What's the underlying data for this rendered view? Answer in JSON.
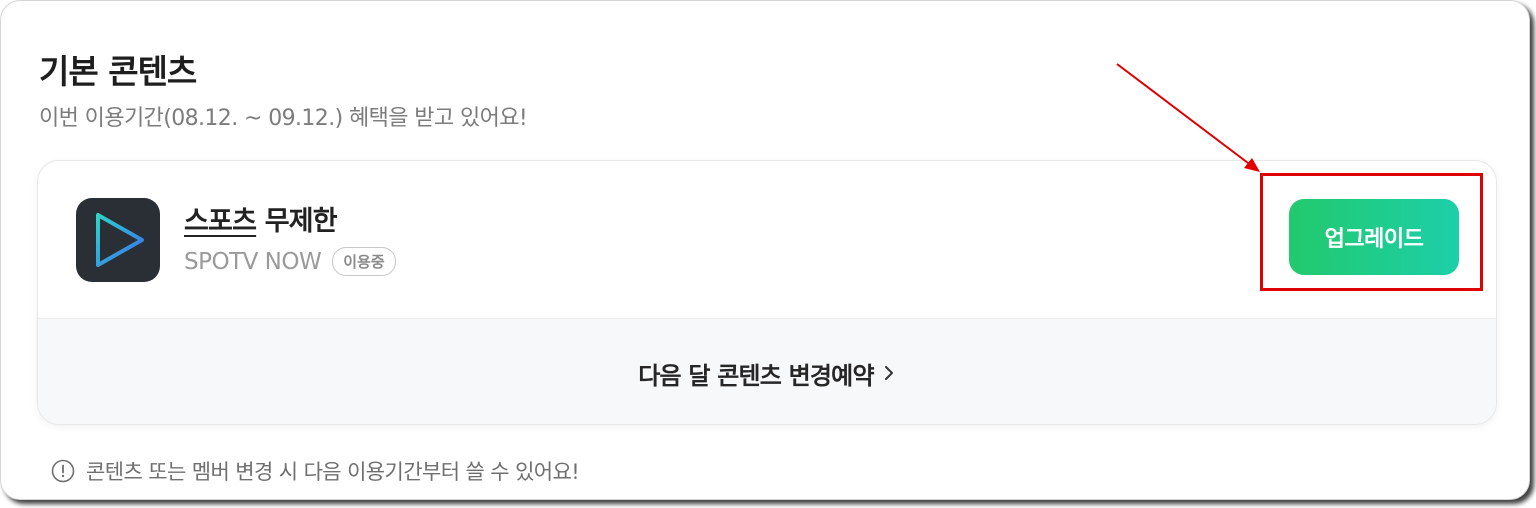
{
  "section": {
    "title": "기본 콘텐츠",
    "subtitle": "이번 이용기간(08.12. ~ 09.12.) 혜택을 받고 있어요!"
  },
  "product": {
    "name_underlined": "스포츠",
    "name_rest": " 무제한",
    "provider": "SPOTV NOW",
    "status_badge": "이용중",
    "icon": "play-triangle-icon",
    "icon_bg_color": "#2a2e35"
  },
  "actions": {
    "upgrade_label": "업그레이드",
    "upgrade_color": "#22c96d",
    "change_reservation_label": "다음 달 콘텐츠 변경예약"
  },
  "notice": {
    "icon": "exclamation-circle-icon",
    "text": "콘텐츠 또는 멤버 변경 시 다음 이용기간부터 쓸 수 있어요!"
  },
  "annotation": {
    "color": "#e00000"
  }
}
